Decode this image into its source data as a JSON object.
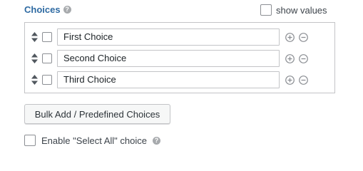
{
  "header": {
    "title": "Choices",
    "help_icon": "?",
    "show_values_label": "show values"
  },
  "choices": [
    {
      "label": "First Choice"
    },
    {
      "label": "Second Choice"
    },
    {
      "label": "Third Choice"
    }
  ],
  "bulk_button_label": "Bulk Add / Predefined Choices",
  "select_all": {
    "label": "Enable \"Select All\" choice",
    "help_icon": "?"
  },
  "icons": {
    "sort": "sort-arrows-icon",
    "add": "plus-circle-icon",
    "remove": "minus-circle-icon",
    "help": "question-circle-icon"
  },
  "colors": {
    "title": "#2e6aa2",
    "icon_gray": "#8c8f94"
  }
}
